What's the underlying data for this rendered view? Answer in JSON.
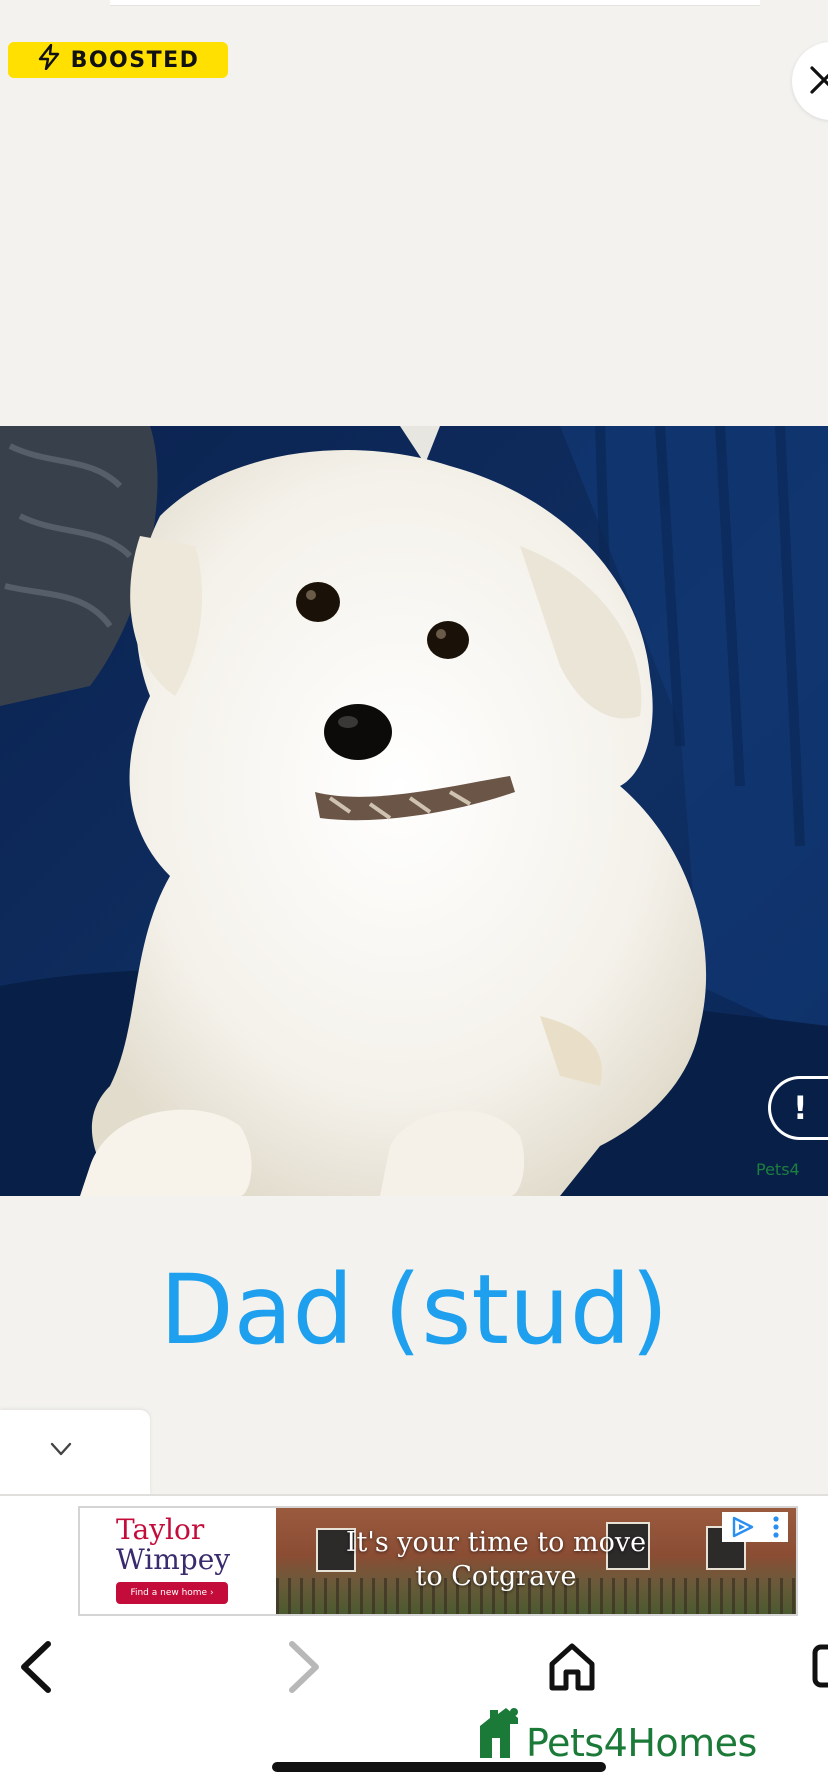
{
  "badge": {
    "label": "BOOSTED",
    "icon": "lightning-bolt-icon",
    "color": "#ffe000"
  },
  "close": {
    "icon": "close-icon"
  },
  "photo": {
    "subject": "white puppy sitting on navy sofa",
    "report_glyph": "!",
    "watermark": "Pets4"
  },
  "caption": {
    "text": "Dad (stud)",
    "color": "#1ea0ee"
  },
  "collapse_tab": {
    "icon": "chevron-down-icon"
  },
  "ad": {
    "brand_line1": "Taylor",
    "brand_line2": "Wimpey",
    "cta": "Find a new home ›",
    "headline_line1": "It's your time to move",
    "headline_line2": "to Cotgrave",
    "choices_icon": "ad-choices-icon",
    "menu_icon": "kebab-menu-icon"
  },
  "nav": {
    "back_icon": "chevron-left-icon",
    "forward_icon": "chevron-right-icon",
    "home_icon": "home-icon",
    "tabs_icon": "tabs-icon"
  },
  "brand": {
    "name": "Pets4Homes",
    "color": "#1b7a37"
  }
}
